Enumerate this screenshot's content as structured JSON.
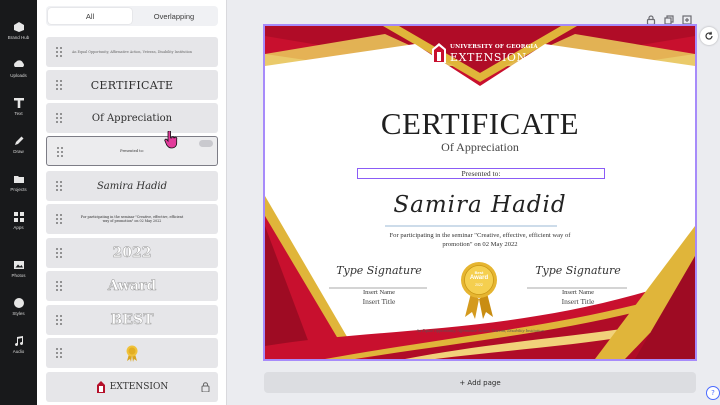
{
  "rail": [
    {
      "label": "Brand Hub",
      "icon": "brand-hub-icon"
    },
    {
      "label": "Uploads",
      "icon": "upload-icon"
    },
    {
      "label": "Text",
      "icon": "text-icon"
    },
    {
      "label": "Draw",
      "icon": "draw-icon"
    },
    {
      "label": "Projects",
      "icon": "folder-icon"
    },
    {
      "label": "Apps",
      "icon": "apps-icon"
    },
    {
      "label": "Photos",
      "icon": "photos-icon"
    },
    {
      "label": "Styles",
      "icon": "styles-icon"
    },
    {
      "label": "Audio",
      "icon": "audio-icon"
    }
  ],
  "panel": {
    "tabs": [
      "All",
      "Overlapping"
    ],
    "active_tab": "All",
    "layers": [
      {
        "text": "An Equal Opportunity, Affirmative Action, Veteran, Disability Institution"
      },
      {
        "text": "CERTIFICATE"
      },
      {
        "text": "Of Appreciation"
      },
      {
        "text": "Presented to:"
      },
      {
        "text": "Samira Hadid"
      },
      {
        "text": "For participating in the seminar \"Creative, effective, efficient way of promotion\" on 02 May 2022"
      },
      {
        "text": "2022"
      },
      {
        "text": "Award"
      },
      {
        "text": "BEST"
      },
      {
        "text": ""
      },
      {
        "text": "EXTENSION"
      }
    ]
  },
  "certificate": {
    "org_top": "UNIVERSITY OF GEORGIA",
    "org_bottom": "EXTENSION",
    "title": "CERTIFICATE",
    "subtitle": "Of Appreciation",
    "presented": "Presented to:",
    "name": "Samira Hadid",
    "description_1": "For participating in the seminar \"Creative, effective, efficient way of",
    "description_2": "promotion\" on 02 May 2022",
    "sig_left": {
      "script": "Type Signature",
      "name": "Insert Name",
      "title": "Insert Title"
    },
    "sig_right": {
      "script": "Type Signature",
      "name": "Insert Name",
      "title": "Insert Title"
    },
    "badge_1": "Best",
    "badge_2": "Award",
    "badge_3": "2022",
    "footer": "An Equal Opportunity, Affirmative Action, Veteran, Disability Institution"
  },
  "canvas": {
    "add_page": "+ Add page"
  },
  "colors": {
    "red": "#c8102e",
    "dark_red": "#9e0b23",
    "gold": "#e0b53a",
    "selection": "#a78bfa"
  }
}
